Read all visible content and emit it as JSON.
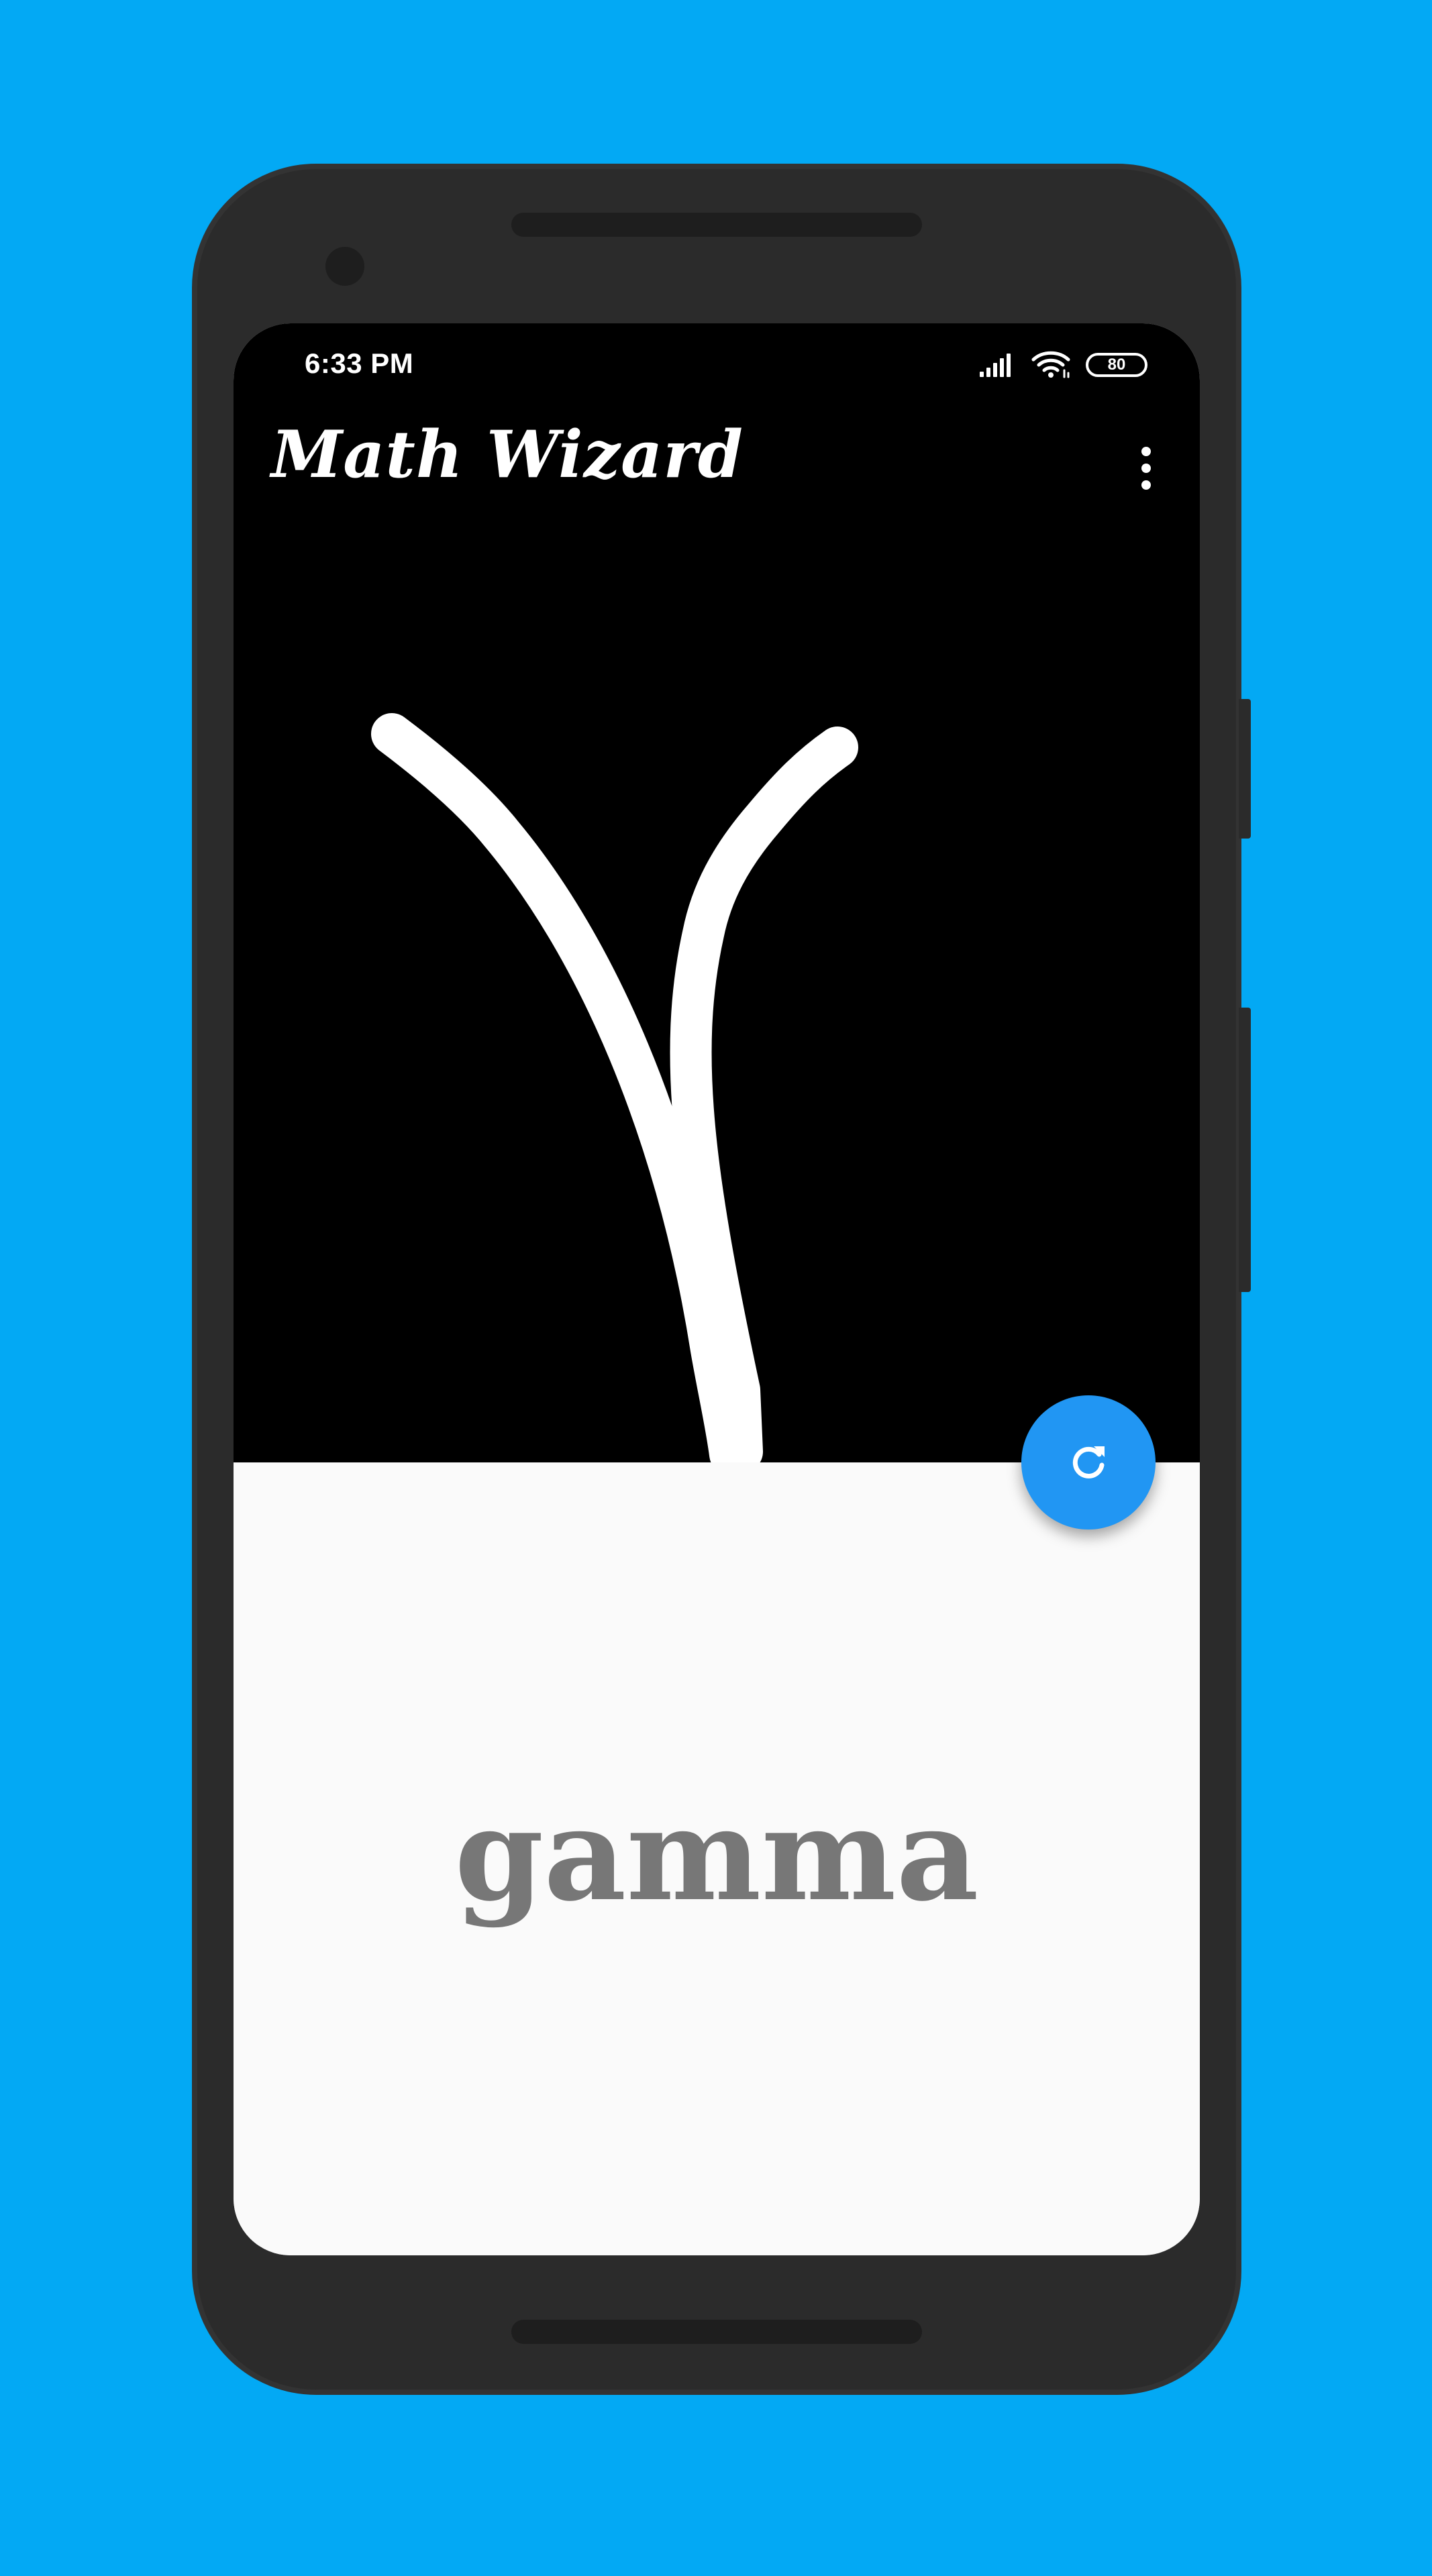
{
  "colors": {
    "background": "#03A9F4",
    "phone_body": "#2B2B2B",
    "phone_detail": "#1E1E1E",
    "canvas": "#000000",
    "stroke": "#FFFFFF",
    "result_panel": "#FAFAFA",
    "result_text": "#777777",
    "fab": "#2196F3",
    "on_dark": "#FFFFFF"
  },
  "status_bar": {
    "time": "6:33 PM",
    "battery": "80",
    "icons": [
      "signal-icon",
      "wifi-icon",
      "battery-icon"
    ]
  },
  "app_bar": {
    "title": "Math Wizard",
    "menu_icon": "more-vert-icon"
  },
  "result": {
    "label": "gamma"
  },
  "fab": {
    "icon": "refresh-icon"
  }
}
